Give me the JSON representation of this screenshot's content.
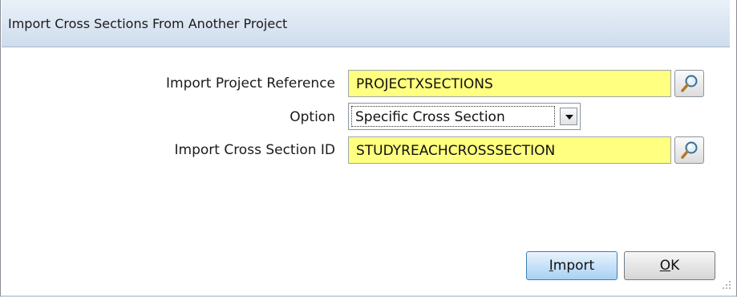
{
  "dialog": {
    "title": "Import Cross Sections From Another Project"
  },
  "form": {
    "project_ref": {
      "label": "Import Project Reference",
      "value": "PROJECTXSECTIONS"
    },
    "option": {
      "label": "Option",
      "selected": "Specific Cross Section"
    },
    "xsection_id": {
      "label": "Import Cross Section ID",
      "value": "STUDYREACHCROSSSECTION"
    }
  },
  "buttons": {
    "import": {
      "mnemonic": "I",
      "rest": "mport"
    },
    "ok": {
      "mnemonic": "O",
      "rest": "K"
    }
  },
  "colors": {
    "required_field": "#ffff80",
    "titlebar": "#dbe6f3",
    "default_button": "#c8e2f8"
  },
  "icons": {
    "lookup": "magnifier-icon",
    "dropdown": "chevron-down-icon",
    "resize": "resize-grip-icon"
  }
}
